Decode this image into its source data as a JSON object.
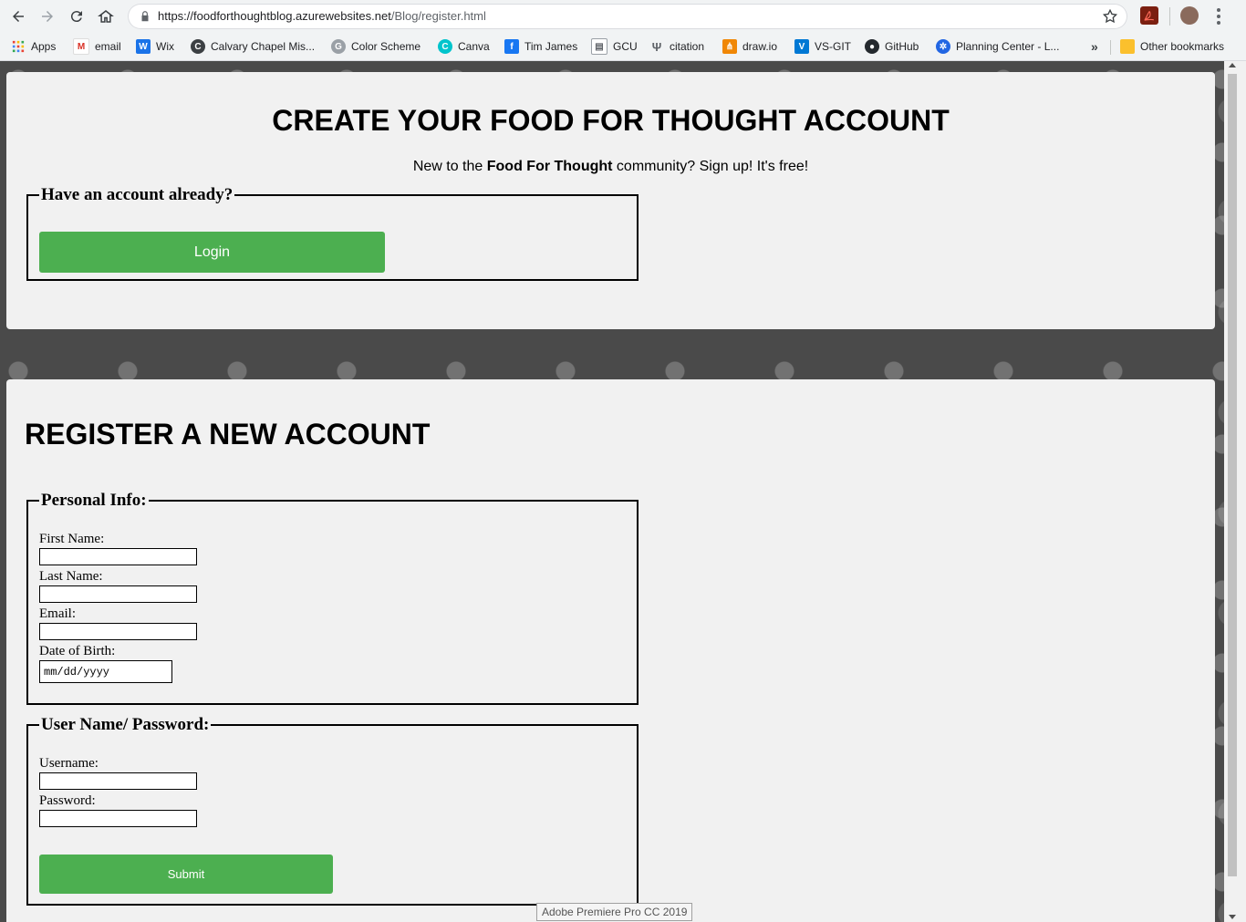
{
  "browser": {
    "url_domain": "https://foodforthoughtblog.azurewebsites.net",
    "url_path": "/Blog/register.html",
    "bookmarks": [
      {
        "label": "Apps",
        "icon": "apps-grid-icon",
        "color": "#ea4335"
      },
      {
        "label": "email",
        "icon": "gmail-icon",
        "color": "#d93025"
      },
      {
        "label": "Wix",
        "icon": "wix-icon",
        "color": "#1a73e8"
      },
      {
        "label": "Calvary Chapel Mis...",
        "icon": "calvary-chapel-icon",
        "color": "#3c4043"
      },
      {
        "label": "Color Scheme",
        "icon": "color-scheme-icon",
        "color": "#9aa0a6"
      },
      {
        "label": "Canva",
        "icon": "canva-icon",
        "color": "#00c4cc"
      },
      {
        "label": "Tim James",
        "icon": "facebook-icon",
        "color": "#1877f2"
      },
      {
        "label": "GCU",
        "icon": "gcu-icon",
        "color": "#5f6368"
      },
      {
        "label": "citation",
        "icon": "citation-icon",
        "color": "#5f6368"
      },
      {
        "label": "draw.io",
        "icon": "drawio-icon",
        "color": "#f08705"
      },
      {
        "label": "VS-GIT",
        "icon": "vs-git-icon",
        "color": "#0078d4"
      },
      {
        "label": "GitHub",
        "icon": "github-icon",
        "color": "#24292e"
      },
      {
        "label": "Planning Center - L...",
        "icon": "planning-center-icon",
        "color": "#2266e3"
      }
    ],
    "overflow_label": "»",
    "other_bookmarks_label": "Other bookmarks"
  },
  "login_section": {
    "title": "CREATE YOUR FOOD FOR THOUGHT ACCOUNT",
    "subtitle_pre": "New to the ",
    "subtitle_bold": "Food For Thought",
    "subtitle_post": " community? Sign up! It's free!",
    "legend": "Have an account already?",
    "login_button": "Login"
  },
  "register_section": {
    "title": "REGISTER A NEW ACCOUNT",
    "personal_legend": "Personal Info:",
    "first_name_label": "First Name:",
    "first_name_value": "",
    "last_name_label": "Last Name:",
    "last_name_value": "",
    "email_label": "Email:",
    "email_value": "",
    "dob_label": "Date of Birth:",
    "dob_placeholder": "mm/dd/yyyy",
    "credentials_legend": "User Name/ Password:",
    "username_label": "Username:",
    "username_value": "",
    "password_label": "Password:",
    "password_value": "",
    "submit_button": "Submit"
  },
  "tooltip": "Adobe Premiere Pro CC 2019",
  "colors": {
    "accent_green": "#4caf50",
    "panel_bg": "#f1f1f1",
    "page_bg": "#4a4a4a"
  }
}
